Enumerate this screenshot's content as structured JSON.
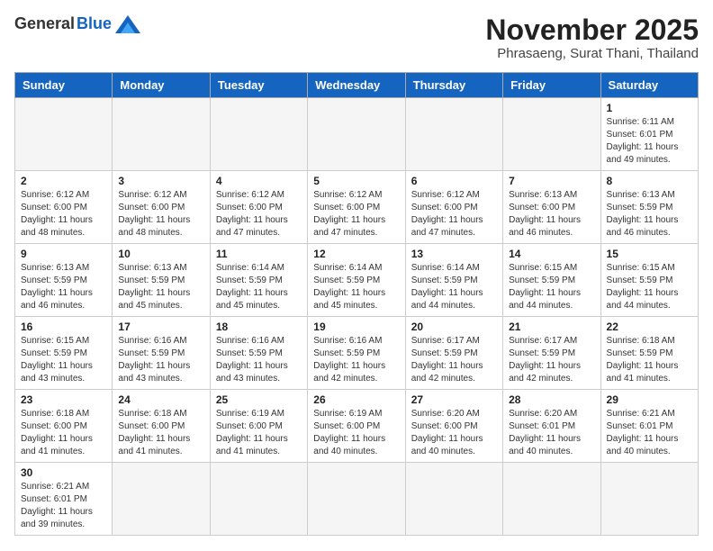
{
  "header": {
    "logo_general": "General",
    "logo_blue": "Blue",
    "month_title": "November 2025",
    "location": "Phrasaeng, Surat Thani, Thailand"
  },
  "days_of_week": [
    "Sunday",
    "Monday",
    "Tuesday",
    "Wednesday",
    "Thursday",
    "Friday",
    "Saturday"
  ],
  "weeks": [
    [
      {
        "day": "",
        "info": ""
      },
      {
        "day": "",
        "info": ""
      },
      {
        "day": "",
        "info": ""
      },
      {
        "day": "",
        "info": ""
      },
      {
        "day": "",
        "info": ""
      },
      {
        "day": "",
        "info": ""
      },
      {
        "day": "1",
        "info": "Sunrise: 6:11 AM\nSunset: 6:01 PM\nDaylight: 11 hours\nand 49 minutes."
      }
    ],
    [
      {
        "day": "2",
        "info": "Sunrise: 6:12 AM\nSunset: 6:00 PM\nDaylight: 11 hours\nand 48 minutes."
      },
      {
        "day": "3",
        "info": "Sunrise: 6:12 AM\nSunset: 6:00 PM\nDaylight: 11 hours\nand 48 minutes."
      },
      {
        "day": "4",
        "info": "Sunrise: 6:12 AM\nSunset: 6:00 PM\nDaylight: 11 hours\nand 47 minutes."
      },
      {
        "day": "5",
        "info": "Sunrise: 6:12 AM\nSunset: 6:00 PM\nDaylight: 11 hours\nand 47 minutes."
      },
      {
        "day": "6",
        "info": "Sunrise: 6:12 AM\nSunset: 6:00 PM\nDaylight: 11 hours\nand 47 minutes."
      },
      {
        "day": "7",
        "info": "Sunrise: 6:13 AM\nSunset: 6:00 PM\nDaylight: 11 hours\nand 46 minutes."
      },
      {
        "day": "8",
        "info": "Sunrise: 6:13 AM\nSunset: 5:59 PM\nDaylight: 11 hours\nand 46 minutes."
      }
    ],
    [
      {
        "day": "9",
        "info": "Sunrise: 6:13 AM\nSunset: 5:59 PM\nDaylight: 11 hours\nand 46 minutes."
      },
      {
        "day": "10",
        "info": "Sunrise: 6:13 AM\nSunset: 5:59 PM\nDaylight: 11 hours\nand 45 minutes."
      },
      {
        "day": "11",
        "info": "Sunrise: 6:14 AM\nSunset: 5:59 PM\nDaylight: 11 hours\nand 45 minutes."
      },
      {
        "day": "12",
        "info": "Sunrise: 6:14 AM\nSunset: 5:59 PM\nDaylight: 11 hours\nand 45 minutes."
      },
      {
        "day": "13",
        "info": "Sunrise: 6:14 AM\nSunset: 5:59 PM\nDaylight: 11 hours\nand 44 minutes."
      },
      {
        "day": "14",
        "info": "Sunrise: 6:15 AM\nSunset: 5:59 PM\nDaylight: 11 hours\nand 44 minutes."
      },
      {
        "day": "15",
        "info": "Sunrise: 6:15 AM\nSunset: 5:59 PM\nDaylight: 11 hours\nand 44 minutes."
      }
    ],
    [
      {
        "day": "16",
        "info": "Sunrise: 6:15 AM\nSunset: 5:59 PM\nDaylight: 11 hours\nand 43 minutes."
      },
      {
        "day": "17",
        "info": "Sunrise: 6:16 AM\nSunset: 5:59 PM\nDaylight: 11 hours\nand 43 minutes."
      },
      {
        "day": "18",
        "info": "Sunrise: 6:16 AM\nSunset: 5:59 PM\nDaylight: 11 hours\nand 43 minutes."
      },
      {
        "day": "19",
        "info": "Sunrise: 6:16 AM\nSunset: 5:59 PM\nDaylight: 11 hours\nand 42 minutes."
      },
      {
        "day": "20",
        "info": "Sunrise: 6:17 AM\nSunset: 5:59 PM\nDaylight: 11 hours\nand 42 minutes."
      },
      {
        "day": "21",
        "info": "Sunrise: 6:17 AM\nSunset: 5:59 PM\nDaylight: 11 hours\nand 42 minutes."
      },
      {
        "day": "22",
        "info": "Sunrise: 6:18 AM\nSunset: 5:59 PM\nDaylight: 11 hours\nand 41 minutes."
      }
    ],
    [
      {
        "day": "23",
        "info": "Sunrise: 6:18 AM\nSunset: 6:00 PM\nDaylight: 11 hours\nand 41 minutes."
      },
      {
        "day": "24",
        "info": "Sunrise: 6:18 AM\nSunset: 6:00 PM\nDaylight: 11 hours\nand 41 minutes."
      },
      {
        "day": "25",
        "info": "Sunrise: 6:19 AM\nSunset: 6:00 PM\nDaylight: 11 hours\nand 41 minutes."
      },
      {
        "day": "26",
        "info": "Sunrise: 6:19 AM\nSunset: 6:00 PM\nDaylight: 11 hours\nand 40 minutes."
      },
      {
        "day": "27",
        "info": "Sunrise: 6:20 AM\nSunset: 6:00 PM\nDaylight: 11 hours\nand 40 minutes."
      },
      {
        "day": "28",
        "info": "Sunrise: 6:20 AM\nSunset: 6:01 PM\nDaylight: 11 hours\nand 40 minutes."
      },
      {
        "day": "29",
        "info": "Sunrise: 6:21 AM\nSunset: 6:01 PM\nDaylight: 11 hours\nand 40 minutes."
      }
    ],
    [
      {
        "day": "30",
        "info": "Sunrise: 6:21 AM\nSunset: 6:01 PM\nDaylight: 11 hours\nand 39 minutes."
      },
      {
        "day": "",
        "info": ""
      },
      {
        "day": "",
        "info": ""
      },
      {
        "day": "",
        "info": ""
      },
      {
        "day": "",
        "info": ""
      },
      {
        "day": "",
        "info": ""
      },
      {
        "day": "",
        "info": ""
      }
    ]
  ]
}
